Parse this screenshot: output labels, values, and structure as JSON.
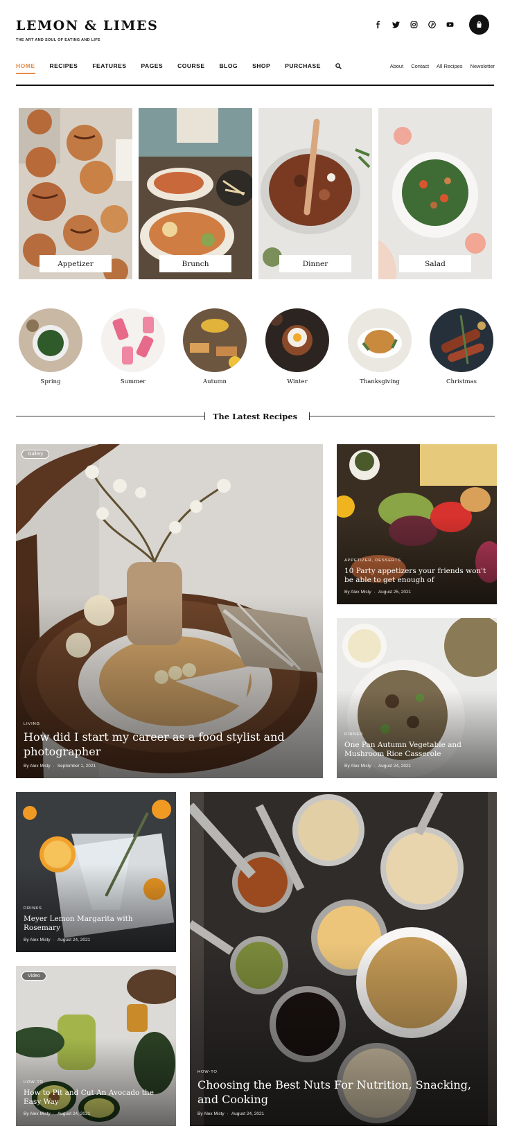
{
  "header": {
    "logo": "LEMON & LIMES",
    "tagline": "THE ART AND SOUL OF EATING AND LIFE",
    "socials": [
      {
        "icon": "facebook-icon",
        "glyph": "f"
      },
      {
        "icon": "twitter-icon",
        "glyph": "t"
      },
      {
        "icon": "instagram-icon",
        "glyph": "i"
      },
      {
        "icon": "pinterest-icon",
        "glyph": "p"
      },
      {
        "icon": "youtube-icon",
        "glyph": "y"
      }
    ],
    "cart_icon": "shopping-bag-icon"
  },
  "nav": {
    "items": [
      "HOME",
      "RECIPES",
      "FEATURES",
      "PAGES",
      "COURSE",
      "BLOG",
      "SHOP",
      "PURCHASE"
    ],
    "active": "HOME",
    "search_icon": "search-icon",
    "secondary": [
      "About",
      "Contact",
      "All Recipes",
      "Newsletter"
    ],
    "accent_color": "#e58a47"
  },
  "categories": [
    "Appetizer",
    "Brunch",
    "Dinner",
    "Salad"
  ],
  "seasons": [
    "Spring",
    "Summer",
    "Autumn",
    "Winter",
    "Thanksgiving",
    "Christmas"
  ],
  "latest": {
    "heading": "The Latest Recipes",
    "posts": {
      "main": {
        "badge": "Gallery",
        "category": "LIVING",
        "title": "How did I start my career as a food stylist and photographer",
        "author": "By Alex Misty",
        "date": "September 1, 2021"
      },
      "party": {
        "category": "APPETIZER, DESSERTS",
        "title": "10 Party appetizers your friends won't be able to get enough of",
        "author": "By Alex Misty",
        "date": "August 25, 2021"
      },
      "casserole": {
        "category": "DINNER",
        "title": "One Pan Autumn Vegetable and Mushroom Rice Casserole",
        "author": "By Alex Misty",
        "date": "August 24, 2021"
      },
      "margarita": {
        "category": "DRINKS",
        "title": "Meyer Lemon Margarita with Rosemary",
        "author": "By Alex Misty",
        "date": "August 24, 2021"
      },
      "avocado": {
        "badge": "Video",
        "category": "HOW-TO",
        "title": "How to Pit and Cut An Avocado the Easy Way",
        "author": "By Alex Misty",
        "date": "August 24, 2021"
      },
      "nuts": {
        "category": "HOW-TO",
        "title": "Choosing the Best Nuts For Nutrition, Snacking, and Cooking",
        "author": "By Alex Misty",
        "date": "August 24, 2021"
      }
    }
  }
}
